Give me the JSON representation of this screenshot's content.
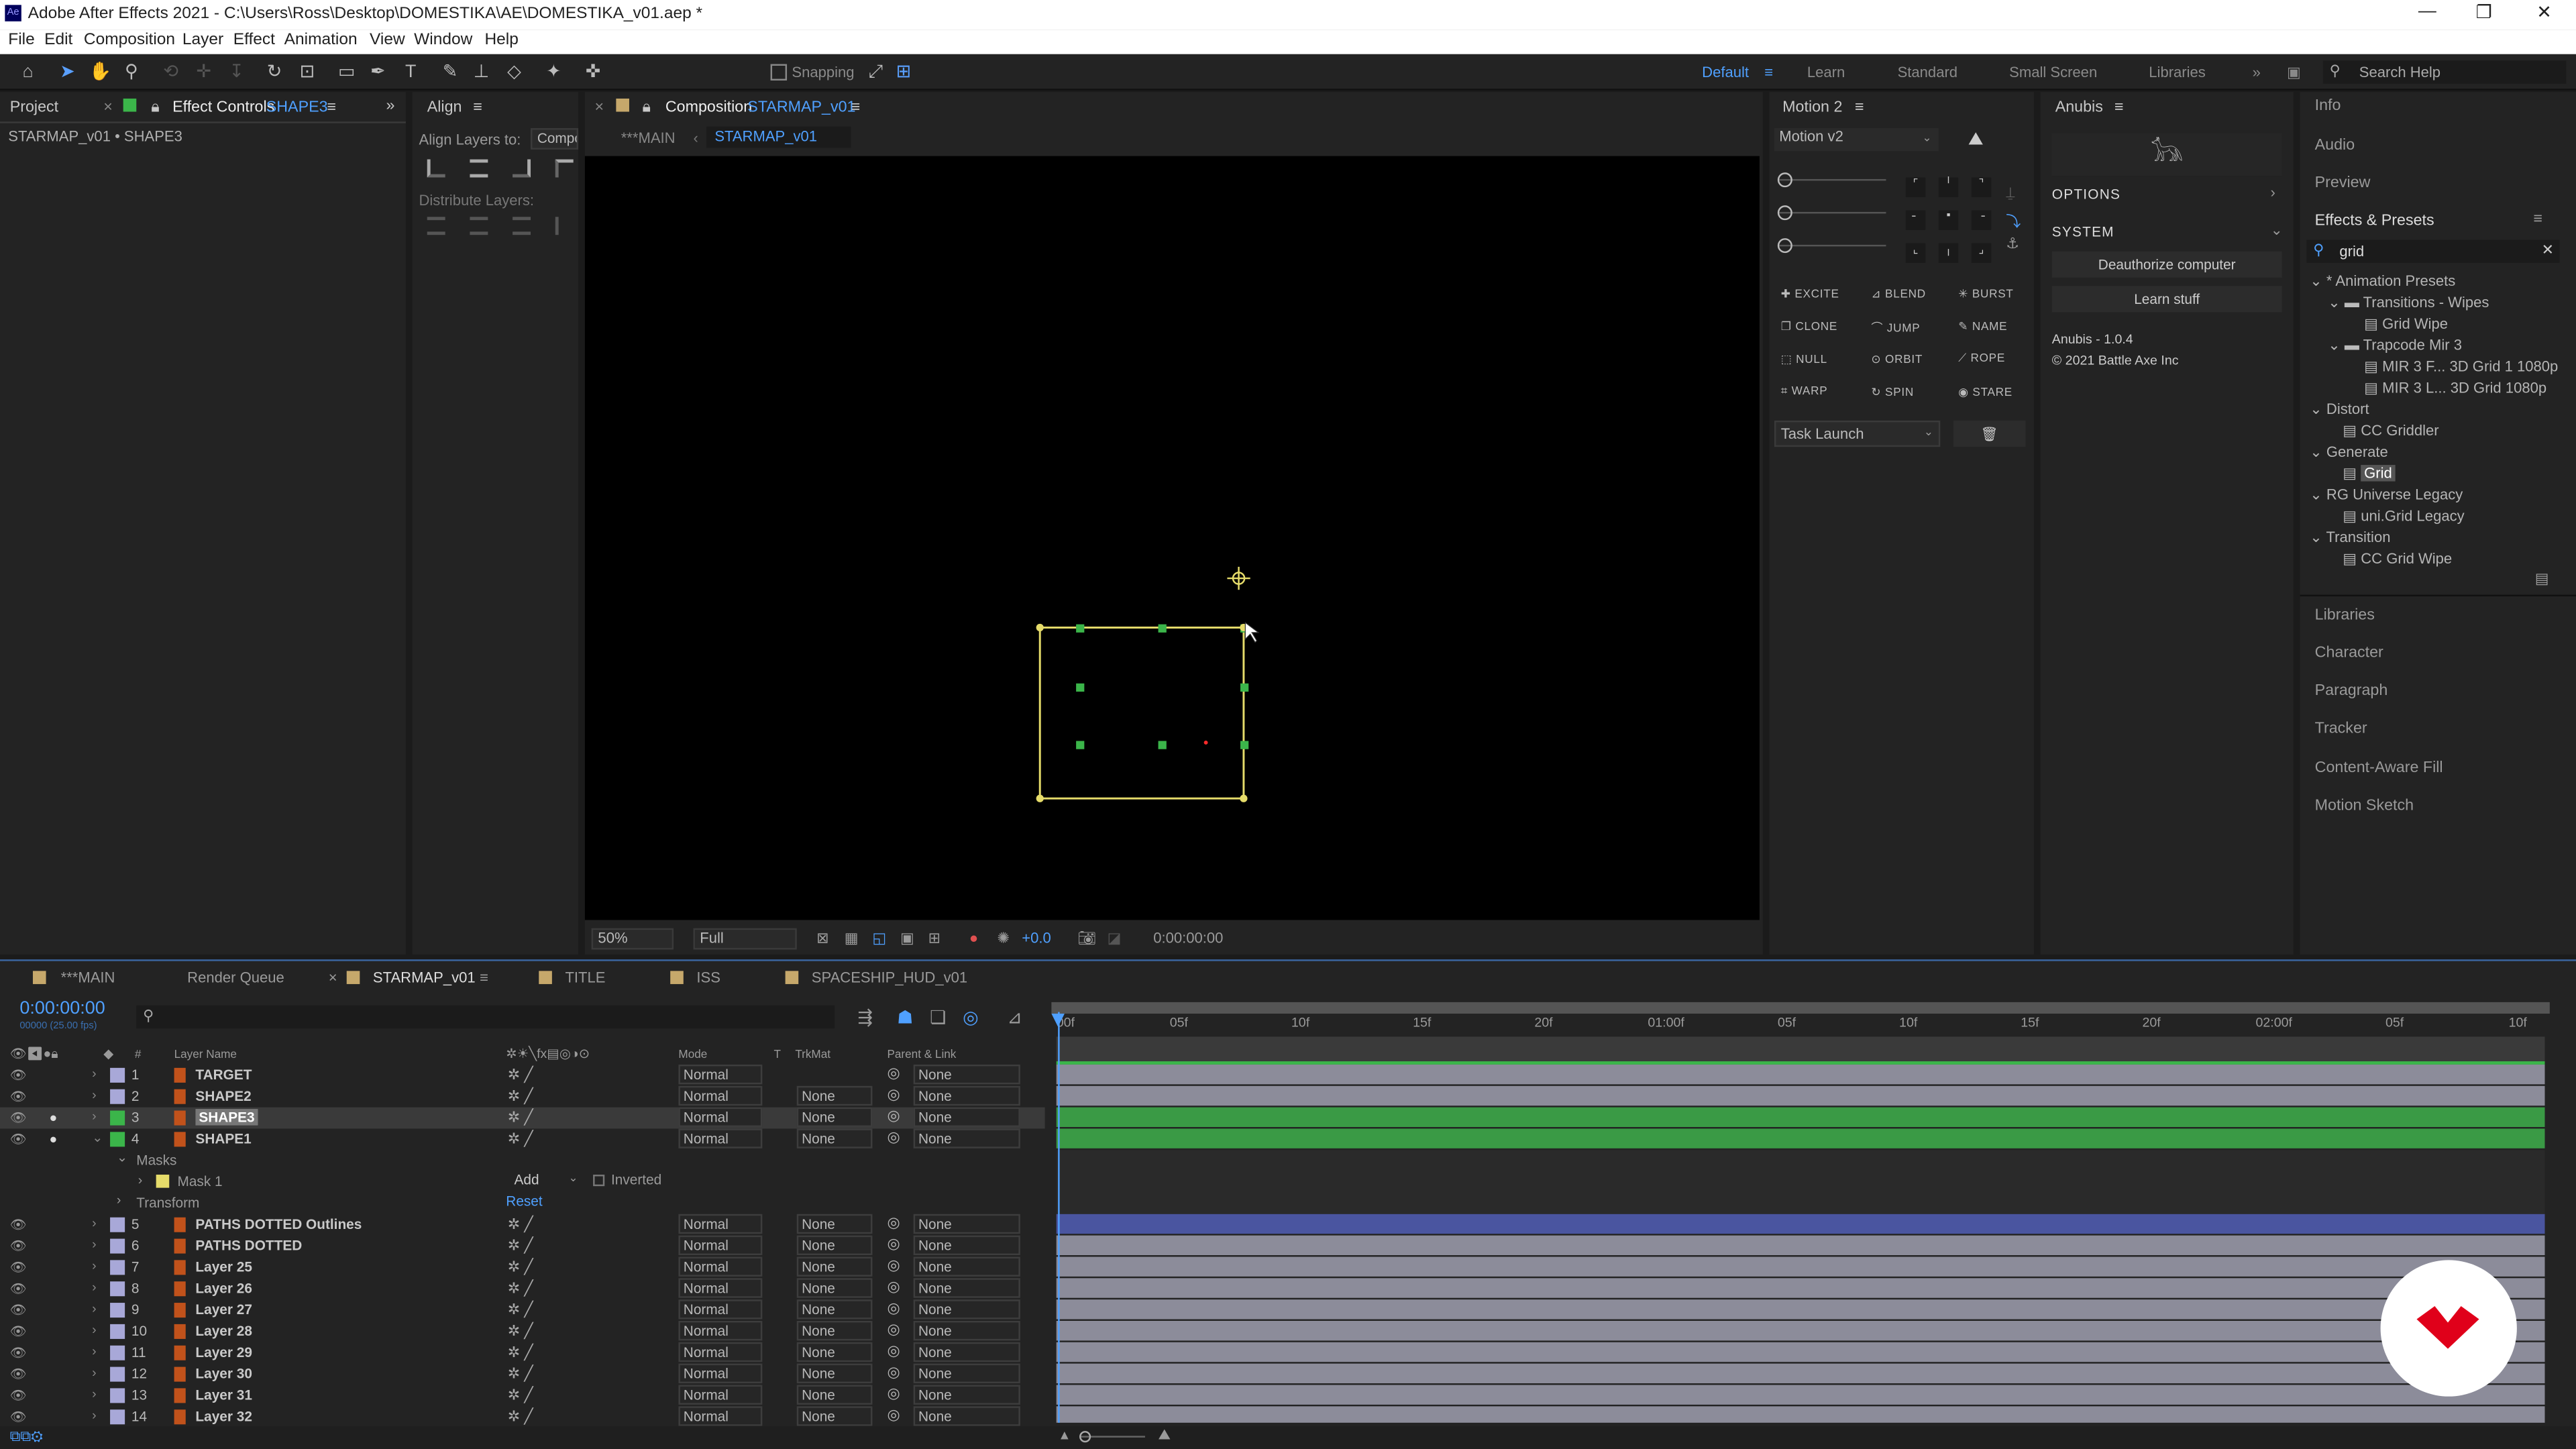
{
  "app": {
    "title": "Adobe After Effects 2021 - C:\\Users\\Ross\\Desktop\\DOMESTIKA\\AE\\DOMESTIKA_v01.aep *",
    "logo": "Ae"
  },
  "menu": [
    "File",
    "Edit",
    "Composition",
    "Layer",
    "Effect",
    "Animation",
    "View",
    "Window",
    "Help"
  ],
  "toolbar": {
    "snapping": "Snapping",
    "workspaces": [
      "Default",
      "Learn",
      "Standard",
      "Small Screen",
      "Libraries"
    ],
    "search": "Search Help"
  },
  "project_panel": {
    "tab_project": "Project",
    "tab_effect": "Effect Controls",
    "tab_effect_layer": "SHAPE3",
    "crumb": "STARMAP_v01 • SHAPE3"
  },
  "align_panel": {
    "tab": "Align",
    "align_to_label": "Align Layers to:",
    "align_to_value": "Compo",
    "distribute": "Distribute Layers:"
  },
  "comp_panel": {
    "tab_prefix": "Composition",
    "tab_comp": "STARMAP_v01",
    "nav_main": "***MAIN",
    "nav_current": "STARMAP_v01",
    "zoom": "50%",
    "resolution": "Full",
    "exposure": "+0.0",
    "time": "0:00:00:00"
  },
  "motion_panel": {
    "tab": "Motion 2",
    "version": "Motion v2",
    "buttons": [
      "EXCITE",
      "BLEND",
      "BURST",
      "CLONE",
      "JUMP",
      "NAME",
      "NULL",
      "ORBIT",
      "ROPE",
      "WARP",
      "SPIN",
      "STARE"
    ],
    "task": "Task Launch"
  },
  "anubis_panel": {
    "tab": "Anubis",
    "options": "OPTIONS",
    "system": "SYSTEM",
    "deauth": "Deauthorize computer",
    "learn": "Learn stuff",
    "version": "Anubis - 1.0.4",
    "copyright": "© 2021 Battle Axe Inc"
  },
  "right_panel": {
    "info": "Info",
    "audio": "Audio",
    "preview": "Preview",
    "effects_tab": "Effects & Presets",
    "search": "grid",
    "tree": [
      "* Animation Presets",
      "Transitions - Wipes",
      "Grid Wipe",
      "Trapcode Mir 3",
      "MIR 3 F... 3D Grid 1 1080p",
      "MIR 3 L... 3D Grid 1080p",
      "Distort",
      "CC Griddler",
      "Generate",
      "Grid",
      "RG Universe Legacy",
      "uni.Grid Legacy",
      "Transition",
      "CC Grid Wipe"
    ],
    "panels": [
      "Libraries",
      "Character",
      "Paragraph",
      "Tracker",
      "Content-Aware Fill",
      "Motion Sketch"
    ]
  },
  "timeline": {
    "tabs": [
      "***MAIN",
      "Render Queue",
      "STARMAP_v01",
      "TITLE",
      "ISS",
      "SPACESHIP_HUD_v01"
    ],
    "timecode": "0:00:00:00",
    "fps": "00000 (25.00 fps)",
    "headers": {
      "num": "#",
      "name": "Layer Name",
      "mode": "Mode",
      "t": "T",
      "trkmat": "TrkMat",
      "parent": "Parent & Link"
    },
    "ruler": [
      "00f",
      "05f",
      "10f",
      "15f",
      "20f",
      "01:00f",
      "05f",
      "10f",
      "15f",
      "20f",
      "02:00f",
      "05f",
      "10f"
    ],
    "layers": [
      {
        "n": "1",
        "name": "TARGET",
        "mode": "Normal",
        "trk": "",
        "parent": "None"
      },
      {
        "n": "2",
        "name": "SHAPE2",
        "mode": "Normal",
        "trk": "None",
        "parent": "None"
      },
      {
        "n": "3",
        "name": "SHAPE3",
        "mode": "Normal",
        "trk": "None",
        "parent": "None"
      },
      {
        "n": "4",
        "name": "SHAPE1",
        "mode": "Normal",
        "trk": "None",
        "parent": "None"
      },
      {
        "n": "5",
        "name": "PATHS DOTTED Outlines",
        "mode": "Normal",
        "trk": "None",
        "parent": "None"
      },
      {
        "n": "6",
        "name": "PATHS DOTTED",
        "mode": "Normal",
        "trk": "None",
        "parent": "None"
      },
      {
        "n": "7",
        "name": "Layer 25",
        "mode": "Normal",
        "trk": "None",
        "parent": "None"
      },
      {
        "n": "8",
        "name": "Layer 26",
        "mode": "Normal",
        "trk": "None",
        "parent": "None"
      },
      {
        "n": "9",
        "name": "Layer 27",
        "mode": "Normal",
        "trk": "None",
        "parent": "None"
      },
      {
        "n": "10",
        "name": "Layer 28",
        "mode": "Normal",
        "trk": "None",
        "parent": "None"
      },
      {
        "n": "11",
        "name": "Layer 29",
        "mode": "Normal",
        "trk": "None",
        "parent": "None"
      },
      {
        "n": "12",
        "name": "Layer 30",
        "mode": "Normal",
        "trk": "None",
        "parent": "None"
      },
      {
        "n": "13",
        "name": "Layer 31",
        "mode": "Normal",
        "trk": "None",
        "parent": "None"
      },
      {
        "n": "14",
        "name": "Layer 32",
        "mode": "Normal",
        "trk": "None",
        "parent": "None"
      }
    ],
    "masks": "Masks",
    "mask1": "Mask 1",
    "mask_mode": "Add",
    "inverted": "Inverted",
    "transform": "Transform",
    "reset": "Reset"
  }
}
